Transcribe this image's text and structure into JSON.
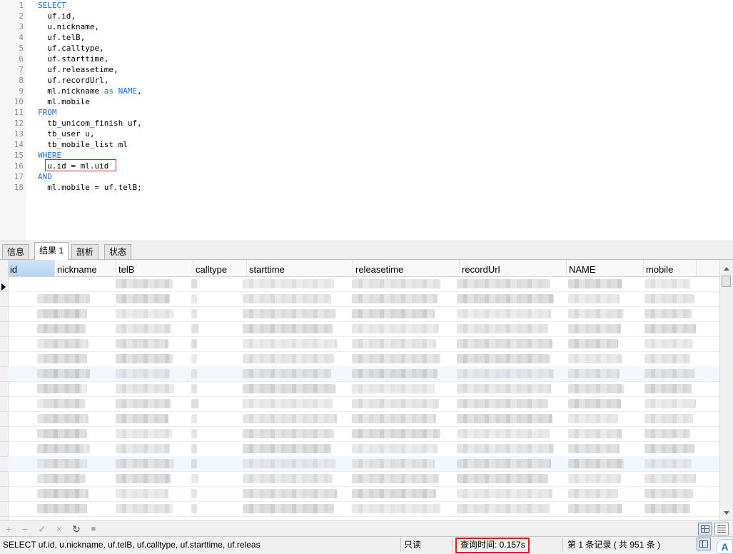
{
  "editor": {
    "lines": [
      {
        "n": "1",
        "parts": [
          {
            "t": "SELECT",
            "kw": true
          }
        ]
      },
      {
        "n": "2",
        "parts": [
          {
            "t": "  uf.id,"
          }
        ]
      },
      {
        "n": "3",
        "parts": [
          {
            "t": "  u.nickname,"
          }
        ]
      },
      {
        "n": "4",
        "parts": [
          {
            "t": "  uf.telB,"
          }
        ]
      },
      {
        "n": "5",
        "parts": [
          {
            "t": "  uf.calltype,"
          }
        ]
      },
      {
        "n": "6",
        "parts": [
          {
            "t": "  uf.starttime,"
          }
        ]
      },
      {
        "n": "7",
        "parts": [
          {
            "t": "  uf.releasetime,"
          }
        ]
      },
      {
        "n": "8",
        "parts": [
          {
            "t": "  uf.recordUrl,"
          }
        ]
      },
      {
        "n": "9",
        "parts": [
          {
            "t": "  ml.nickname "
          },
          {
            "t": "as",
            "kw": true
          },
          {
            "t": " "
          },
          {
            "t": "NAME",
            "kw": true
          },
          {
            "t": ","
          }
        ]
      },
      {
        "n": "10",
        "parts": [
          {
            "t": "  ml.mobile"
          }
        ]
      },
      {
        "n": "11",
        "parts": [
          {
            "t": "FROM",
            "kw": true
          }
        ]
      },
      {
        "n": "12",
        "parts": [
          {
            "t": "  tb_unicom_finish uf,"
          }
        ]
      },
      {
        "n": "13",
        "parts": [
          {
            "t": "  tb_user u,"
          }
        ]
      },
      {
        "n": "14",
        "parts": [
          {
            "t": "  tb_mobile_list ml"
          }
        ]
      },
      {
        "n": "15",
        "parts": [
          {
            "t": "WHERE",
            "kw": true
          }
        ]
      },
      {
        "n": "16",
        "parts": [
          {
            "t": "  u.id = ml.uid"
          }
        ]
      },
      {
        "n": "17",
        "parts": [
          {
            "t": "AND",
            "kw": true
          }
        ]
      },
      {
        "n": "18",
        "parts": [
          {
            "t": "  ml.mobile = uf.telB;"
          }
        ]
      }
    ]
  },
  "tabs": [
    {
      "label": "信息",
      "active": false
    },
    {
      "label": "结果 1",
      "active": true
    },
    {
      "label": "剖析",
      "active": false
    },
    {
      "label": "状态",
      "active": false
    }
  ],
  "grid": {
    "columns": [
      "id",
      "nickname",
      "telB",
      "calltype",
      "starttime",
      "releasetime",
      "recordUrl",
      "NAME",
      "mobile"
    ],
    "selected_column": "id"
  },
  "toolbar": {
    "add_icon": "+",
    "delete_icon": "−",
    "apply_icon": "✓",
    "discard_icon": "×",
    "refresh_icon": "↻",
    "stop_icon": "■"
  },
  "statusbar": {
    "sql_preview": "SELECT    uf.id,      u.nickname,             uf.telB,     uf.calltype,              uf.starttime,              uf.releas",
    "readonly": "只读",
    "query_time": "查询时间: 0.157s",
    "record_info": "第 1 条记录 ( 共 951 条 )"
  },
  "corner_badge": "A",
  "colors": {
    "keyword": "#1b6fd8",
    "highlight_border": "#d42020",
    "selected_header": "#b8d5f3"
  }
}
